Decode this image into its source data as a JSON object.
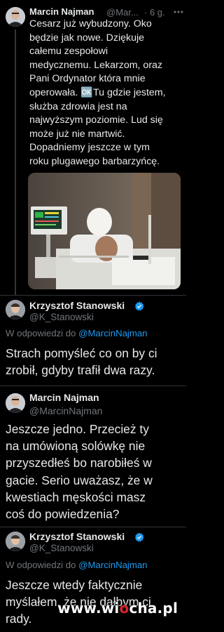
{
  "tweets": [
    {
      "author_name": "Marcin Najman",
      "author_handle": "@Mar...",
      "time": "· 6 g.",
      "text_lines": [
        "Cesarz już wybudzony. Oko",
        "będzie jak nowe. Dziękuje",
        "całemu zespołowi",
        "medycznemu. Lekarzom, oraz",
        "Pani Ordynator która mnie",
        "operowała. 🆗Tu gdzie jestem,",
        "służba zdrowia jest na",
        "najwyższym poziomie. Lud się",
        "może już nie martwić.",
        "Dopadniemy jeszcze w tym",
        "roku plugawego barbarzyńcę."
      ]
    },
    {
      "author_name": "Krzysztof Stanowski",
      "author_handle": "@K_Stanowski",
      "reply_prefix": "W odpowiedzi do",
      "reply_mention": "@MarcinNajman",
      "text_lines": [
        "Strach pomyśleć co on by ci",
        "zrobił, gdyby trafił dwa razy."
      ]
    },
    {
      "author_name": "Marcin Najman",
      "author_handle": "@MarcinNajman",
      "text_lines": [
        "Jeszcze jedno. Przecież ty",
        "na umówioną solówkę nie",
        "przyszedłeś bo narobiłeś w",
        "gacie. Serio uważasz, że w",
        "kwestiach męskości masz",
        "coś do powiedzenia?"
      ]
    },
    {
      "author_name": "Krzysztof Stanowski",
      "author_handle": "@K_Stanowski",
      "reply_prefix": "W odpowiedzi do",
      "reply_mention": "@MarcinNajman",
      "text_lines": [
        "Jeszcze wtedy faktycznie",
        "myślałem, że nie dałbym ci",
        "rady."
      ]
    }
  ],
  "icons": {
    "more": "more-icon",
    "verified": "verified-badge-icon"
  },
  "colors": {
    "background": "#000000",
    "text": "#e7e9ea",
    "muted": "#71767b",
    "link": "#1d9bf0",
    "divider": "#2f3336"
  },
  "watermark": {
    "prefix": "www.wi",
    "accent": "o",
    "suffix": "cha.pl"
  }
}
